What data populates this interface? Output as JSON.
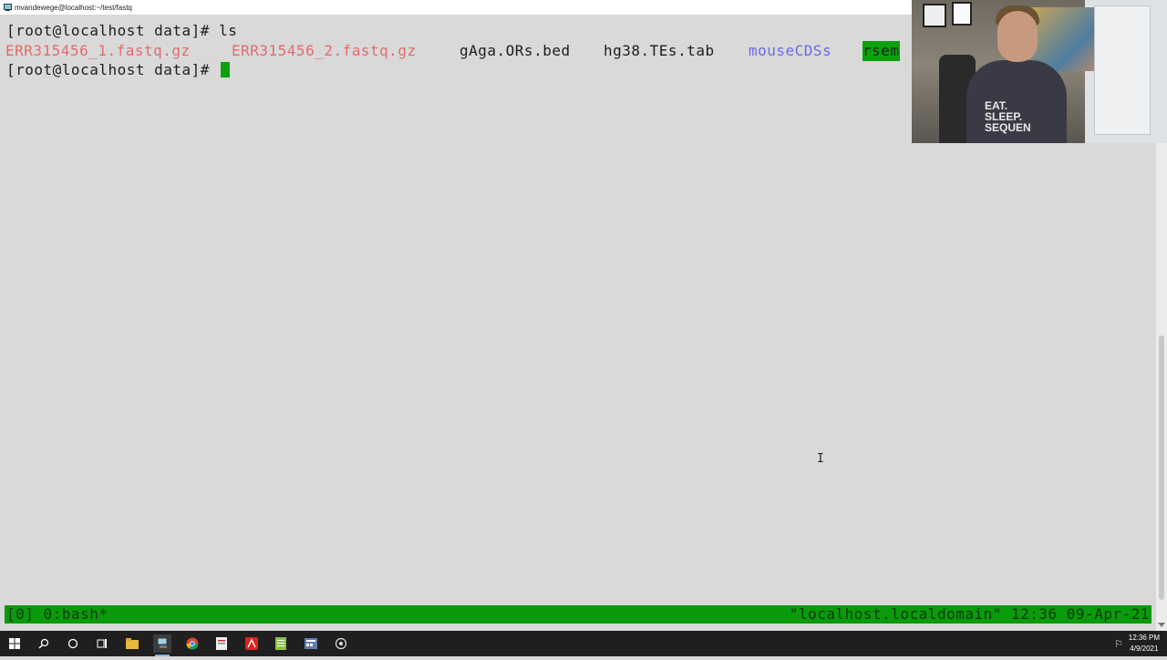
{
  "window": {
    "title": "mvandewege@localhost:~/test/fastq"
  },
  "terminal": {
    "prompt": "[root@localhost data]# ",
    "command": "ls",
    "files": [
      {
        "name": "ERR315456_1.fastq.gz",
        "color": "#e06c6c"
      },
      {
        "name": "ERR315456_2.fastq.gz",
        "color": "#e06c6c"
      },
      {
        "name": "gAga.ORs.bed",
        "color": "#1e1e1e"
      },
      {
        "name": "hg38.TEs.tab",
        "color": "#1e1e1e"
      },
      {
        "name": "mouseCDSs",
        "color": "#6a6ae8"
      },
      {
        "name": "rsem",
        "color": "#1e1e1e",
        "background": "#0aa10a"
      }
    ]
  },
  "tmux": {
    "left": "[0] 0:bash*",
    "right": "\"localhost.localdomain\" 12:36 09-Apr-21",
    "color": "#0b9a0b"
  },
  "webcam": {
    "shirt_text": "EAT.\nSLEEP.\nSEQUEN"
  },
  "taskbar": {
    "icons": [
      "windows-start-icon",
      "search-icon",
      "cortana-icon",
      "task-view-icon",
      "file-explorer-icon",
      "putty-icon",
      "chrome-icon",
      "app-icon",
      "acrobat-icon",
      "notepad-icon",
      "calculator-icon",
      "settings-icon"
    ],
    "time": "12:36 PM",
    "date": "4/9/2021"
  }
}
